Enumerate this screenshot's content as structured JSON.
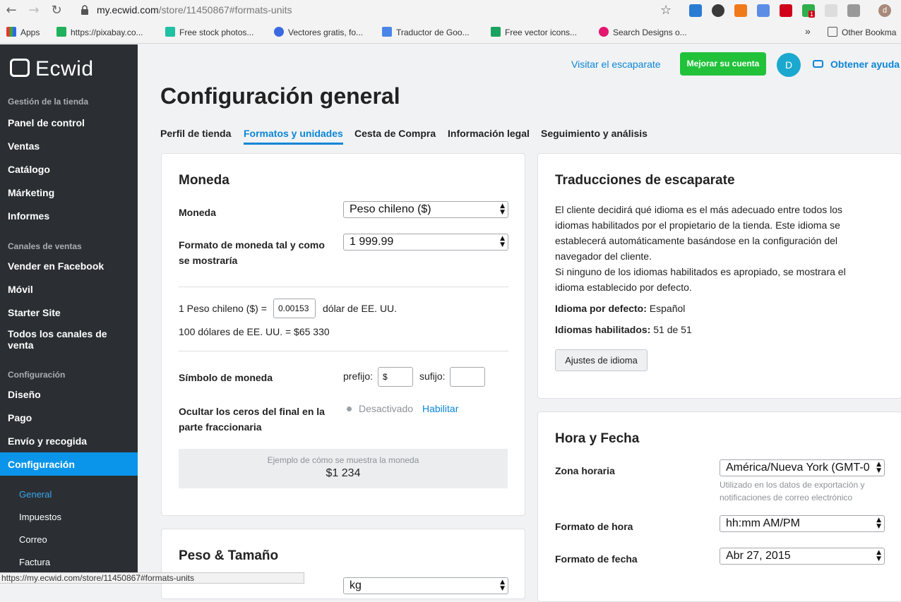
{
  "browser": {
    "url_host": "my.ecwid.com",
    "url_path": "/store/11450867#formats-units",
    "bookmarks": [
      "Apps",
      "https://pixabay.co...",
      "Free stock photos...",
      "Vectores gratis, fo...",
      "Traductor de Goo...",
      "Free vector icons...",
      "Search Designs o...",
      "Other Bookma"
    ],
    "overflow": "»",
    "status_url": "https://my.ecwid.com/store/11450867#formats-units",
    "extension_badge": "1",
    "profile_initial": "d"
  },
  "sidebar": {
    "logo": "Ecwid",
    "sections": [
      {
        "title": "Gestión de la tienda",
        "items": [
          "Panel de control",
          "Ventas",
          "Catálogo",
          "Márketing",
          "Informes"
        ]
      },
      {
        "title": "Canales de ventas",
        "items": [
          "Vender en Facebook",
          "Móvil",
          "Starter Site",
          "Todos los canales de venta"
        ]
      },
      {
        "title": "Configuración",
        "items": [
          "Diseño",
          "Pago",
          "Envío y recogida",
          "Configuración"
        ]
      }
    ],
    "subitems": [
      "General",
      "Impuestos",
      "Correo",
      "Factura"
    ]
  },
  "header": {
    "visit_store": "Visitar el escaparate",
    "upgrade": "Mejorar su cuenta",
    "avatar": "D",
    "help": "Obtener ayuda"
  },
  "page": {
    "title": "Configuración general",
    "tabs": [
      "Perfil de tienda",
      "Formatos y unidades",
      "Cesta de Compra",
      "Información legal",
      "Seguimiento y análisis"
    ]
  },
  "currency": {
    "title": "Moneda",
    "currency_label": "Moneda",
    "currency_value": "Peso chileno ($)",
    "format_label": "Formato de moneda tal y como se mostraría",
    "format_value": "1 999.99",
    "rate_prefix": "1 Peso chileno ($) =",
    "rate_value": "0.00153",
    "rate_suffix": "dólar de EE. UU.",
    "rate_example": "100 dólares de EE. UU. = $65 330",
    "symbol_label": "Símbolo de moneda",
    "prefix_label": "prefijo:",
    "prefix_value": "$",
    "suffix_label": "sufijo:",
    "suffix_value": "",
    "zeros_label": "Ocultar los ceros del final en la parte fraccionaria",
    "zeros_status": "Desactivado",
    "zeros_enable": "Habilitar",
    "example_caption": "Ejemplo de cómo se muestra la moneda",
    "example_value": "$1 234"
  },
  "weight": {
    "title": "Peso & Tamaño",
    "unit_value": "kg"
  },
  "translations": {
    "title": "Traducciones de escaparate",
    "description": "El cliente decidirá qué idioma es el más adecuado entre todos los idiomas habilitados por el propietario de la tienda. Este idioma se establecerá automáticamente basándose en la configuración del navegador del cliente.",
    "description2": "Si ninguno de los idiomas habilitados es apropiado, se mostrara el idioma establecido por defecto.",
    "default_label": "Idioma por defecto:",
    "default_value": "Español",
    "enabled_label": "Idiomas habilitados:",
    "enabled_value": "51 de 51",
    "button": "Ajustes de idioma"
  },
  "datetime": {
    "title": "Hora y Fecha",
    "tz_label": "Zona horaria",
    "tz_value": "América/Nueva York (GMT-0",
    "tz_hint": "Utilizado en los datos de exportación y notificaciones de correo electrónico",
    "time_label": "Formato de hora",
    "time_value": "hh:mm AM/PM",
    "date_label": "Formato de fecha",
    "date_value": "Abr 27, 2015"
  },
  "colors": {
    "accent": "#0b86d7",
    "sidebar_bg": "#2b2f33",
    "sidebar_active": "#0b95ea",
    "upgrade_green": "#21c23a"
  }
}
